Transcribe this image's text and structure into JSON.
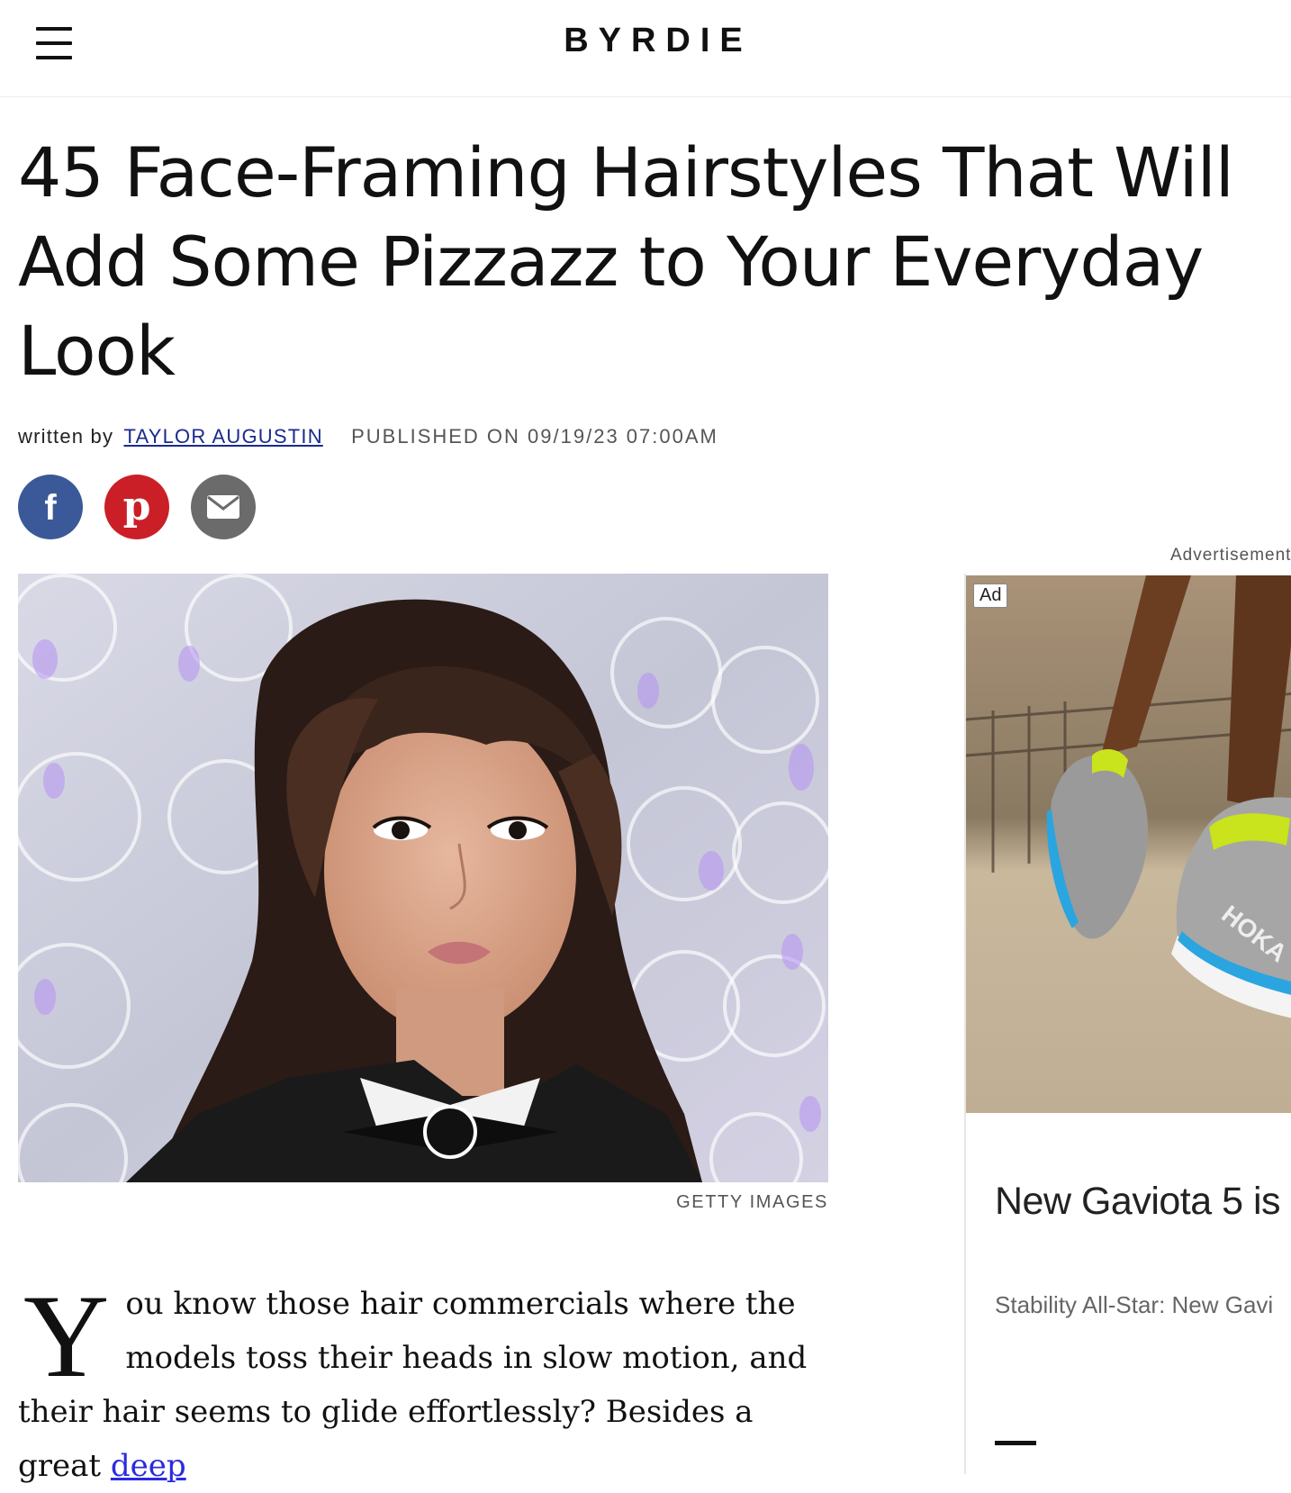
{
  "header": {
    "logo": "BYRDIE"
  },
  "article": {
    "title": "45 Face-Framing Hairstyles That Will Add Some Pizzazz to Your Everyday Look",
    "byline_prefix": "written by",
    "author": "Taylor Augustin",
    "published": "Published on 09/19/23 07:00AM",
    "image_credit": "Getty Images",
    "dropcap": "Y",
    "body_lead": "ou know those hair commercials where the models toss their heads in slow motion, and their hair seems to glide effortlessly? Besides a great ",
    "body_link": "deep"
  },
  "share": {
    "facebook_icon": "facebook-icon",
    "pinterest_icon": "pinterest-icon",
    "email_icon": "email-icon",
    "colors": {
      "facebook": "#3b5998",
      "pinterest": "#cb1f27",
      "email": "#6b6b6b"
    }
  },
  "ad": {
    "label": "Advertisement",
    "badge": "Ad",
    "brand_on_shoe": "HOKA",
    "headline": "New Gaviota 5 is",
    "subtext": "Stability All-Star: New Gavi"
  },
  "colors": {
    "author_link": "#1a2a8c",
    "body_link": "#2a2ae0"
  }
}
